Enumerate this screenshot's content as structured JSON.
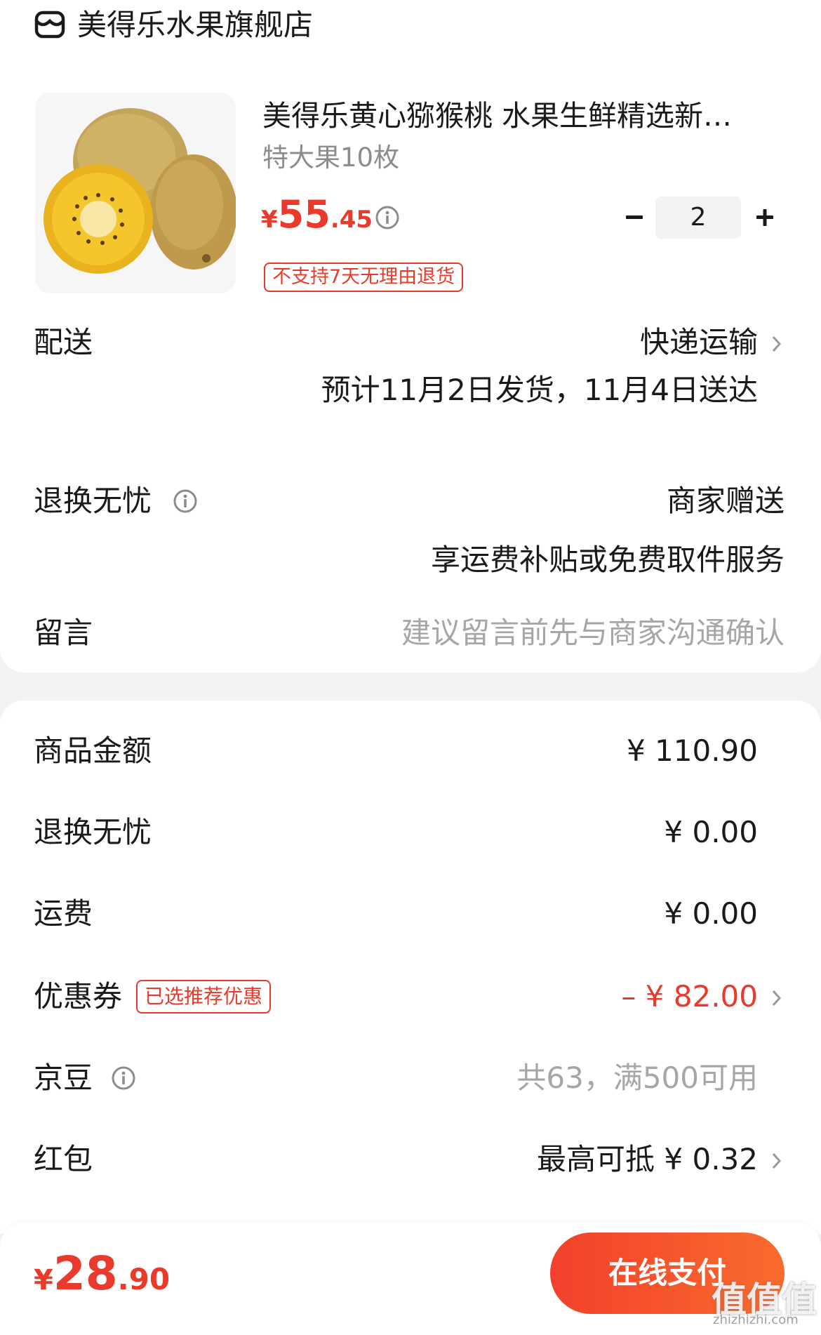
{
  "store": {
    "name": "美得乐水果旗舰店",
    "icon": "store-icon"
  },
  "product": {
    "title": "美得乐黄心猕猴桃 水果生鲜精选新…",
    "spec": "特大果10枚",
    "price_symbol": "¥",
    "price_int": "55",
    "price_dec": ".45",
    "quantity": "2",
    "return_tag": "不支持7天无理由退货"
  },
  "delivery": {
    "label": "配送",
    "method": "快递运输",
    "estimate": "预计11月2日发货，11月4日送达"
  },
  "worry_free": {
    "label": "退换无忧",
    "value": "商家赠送",
    "desc": "享运费补贴或免费取件服务"
  },
  "message": {
    "label": "留言",
    "placeholder": "建议留言前先与商家沟通确认"
  },
  "summary": [
    {
      "label": "商品金额",
      "value": "¥ 110.90"
    },
    {
      "label": "退换无忧",
      "value": "¥ 0.00"
    },
    {
      "label": "运费",
      "value": "¥ 0.00"
    },
    {
      "label": "优惠券",
      "tag": "已选推荐优惠",
      "value": "– ¥ 82.00"
    },
    {
      "label": "京豆",
      "value": "共63，满500可用"
    },
    {
      "label": "红包",
      "value": "最高可抵 ¥ 0.32"
    }
  ],
  "footer": {
    "total_symbol": "¥",
    "total_int": "28",
    "total_dec": ".90",
    "pay_label": "在线支付"
  },
  "watermark": {
    "main": "值值值",
    "sub": "zhizhizhi.com"
  },
  "colors": {
    "accent": "#e93a2b",
    "muted": "#a6a6a6",
    "page_bg": "#f3f3f3"
  }
}
